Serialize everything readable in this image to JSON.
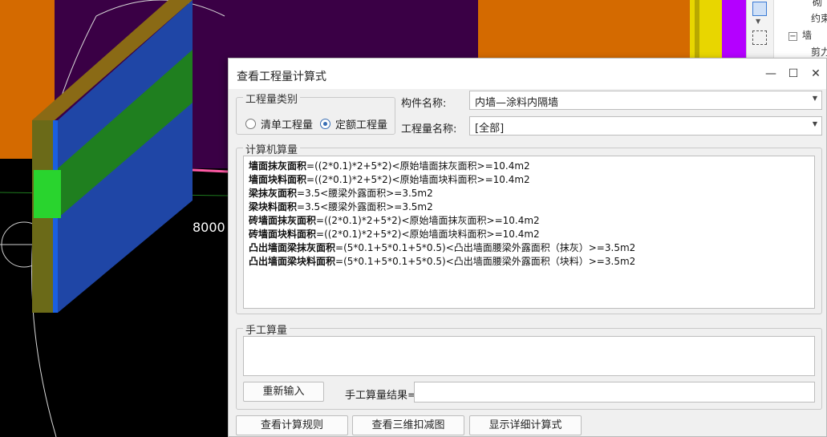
{
  "viewport": {
    "dimension_label": "8000",
    "colors": {
      "orange": "#d46a00",
      "purple": "#3a0045",
      "violet": "#b400ff",
      "yellow": "#e8d600",
      "wall_blue": "#1f46a6",
      "wall_green": "#1f7f1f",
      "wall_olive": "#6b6a18",
      "wall_top": "#8a6a15",
      "accent_green": "#29d42e",
      "pink_line": "#ff5aa5"
    }
  },
  "side_panel": {
    "tree": [
      {
        "label": "砌"
      },
      {
        "label": "约束"
      },
      {
        "label": "墙",
        "toggle": "−"
      },
      {
        "label": "剪力"
      }
    ]
  },
  "dialog": {
    "title": "查看工程量计算式",
    "minimize": "—",
    "maximize": "☐",
    "close": "✕",
    "quantity_type": {
      "title": "工程量类别",
      "options": [
        {
          "label": "清单工程量",
          "checked": false
        },
        {
          "label": "定额工程量",
          "checked": true
        }
      ]
    },
    "component_name": {
      "label": "构件名称:",
      "value": "内墙—涂料内隔墙"
    },
    "quantity_name": {
      "label": "工程量名称:",
      "value": "[全部]"
    },
    "computer_calc": {
      "title": "计算机算量",
      "lines": [
        {
          "name": "墙面抹灰面积",
          "formula": "=((2*0.1)*2+5*2)<原始墙面抹灰面积>=10.4m2"
        },
        {
          "name": "墙面块料面积",
          "formula": "=((2*0.1)*2+5*2)<原始墙面块料面积>=10.4m2"
        },
        {
          "name": "梁抹灰面积",
          "formula": "=3.5<腰梁外露面积>=3.5m2"
        },
        {
          "name": "梁块料面积",
          "formula": "=3.5<腰梁外露面积>=3.5m2"
        },
        {
          "name": "砖墙面抹灰面积",
          "formula": "=((2*0.1)*2+5*2)<原始墙面抹灰面积>=10.4m2"
        },
        {
          "name": "砖墙面块料面积",
          "formula": "=((2*0.1)*2+5*2)<原始墙面块料面积>=10.4m2"
        },
        {
          "name": "凸出墙面梁抹灰面积",
          "formula": "=(5*0.1+5*0.1+5*0.5)<凸出墙面腰梁外露面积（抹灰）>=3.5m2"
        },
        {
          "name": "凸出墙面梁块料面积",
          "formula": "=(5*0.1+5*0.1+5*0.5)<凸出墙面腰梁外露面积（块料）>=3.5m2"
        }
      ]
    },
    "manual_calc": {
      "title": "手工算量",
      "reenter_button": "重新输入",
      "result_label": "手工算量结果=",
      "result_value": ""
    },
    "bottom_buttons": {
      "rules": "查看计算规则",
      "view3d": "查看三维扣减图",
      "detail": "显示详细计算式"
    }
  }
}
